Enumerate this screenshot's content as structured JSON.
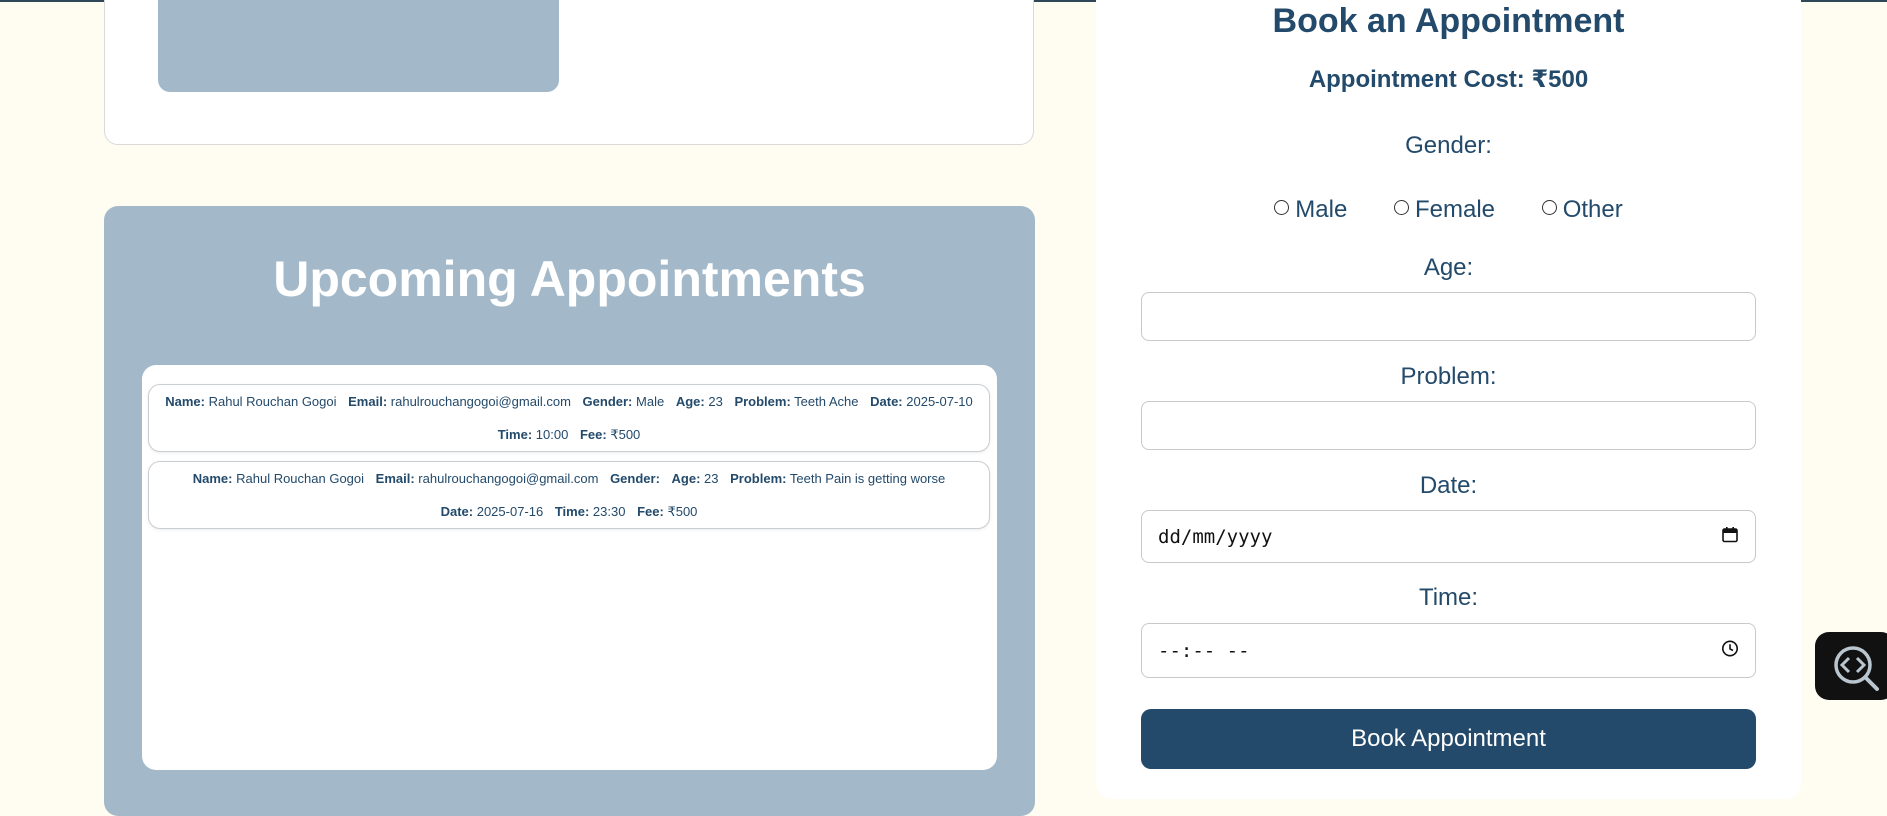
{
  "booking": {
    "title": "Book an Appointment",
    "cost": "Appointment Cost: ₹500",
    "gender_label": "Gender:",
    "gender_options": [
      "Male",
      "Female",
      "Other"
    ],
    "age_label": "Age:",
    "age_value": "",
    "problem_label": "Problem:",
    "problem_value": "",
    "date_label": "Date:",
    "date_placeholder": "dd/mm/yyyy",
    "time_label": "Time:",
    "time_placeholder": "--:-- --",
    "submit_label": "Book Appointment"
  },
  "upcoming": {
    "title": "Upcoming Appointments",
    "items": [
      {
        "name_label": "Name:",
        "name": "Rahul Rouchan Gogoi",
        "email_label": "Email:",
        "email": "rahulrouchangogoi@gmail.com",
        "gender_label": "Gender:",
        "gender": "Male",
        "age_label": "Age:",
        "age": "23",
        "problem_label": "Problem:",
        "problem": "Teeth Ache",
        "date_label": "Date:",
        "date": "2025-07-10",
        "time_label": "Time:",
        "time": "10:00",
        "fee_label": "Fee:",
        "fee": "₹500"
      },
      {
        "name_label": "Name:",
        "name": "Rahul Rouchan Gogoi",
        "email_label": "Email:",
        "email": "rahulrouchangogoi@gmail.com",
        "gender_label": "Gender:",
        "gender": "",
        "age_label": "Age:",
        "age": "23",
        "problem_label": "Problem:",
        "problem": "Teeth Pain is getting worse",
        "date_label": "Date:",
        "date": "2025-07-16",
        "time_label": "Time:",
        "time": "23:30",
        "fee_label": "Fee:",
        "fee": "₹500"
      }
    ]
  },
  "icons": {
    "calendar": "calendar-icon",
    "clock": "clock-icon",
    "inspect": "code-search-icon"
  },
  "colors": {
    "background": "#fffcf2",
    "primary": "#234a6b",
    "panel": "#a3b9c9",
    "card": "#ffffff"
  }
}
